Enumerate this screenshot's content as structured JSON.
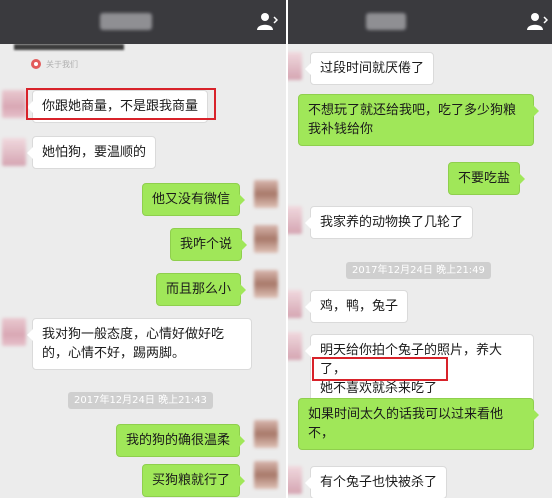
{
  "left_panel": {
    "note_text": "关于我们",
    "messages": [
      {
        "side": "in",
        "text": "你跟她商量，不是跟我商量"
      },
      {
        "side": "in",
        "text": "她怕狗，要温顺的"
      },
      {
        "side": "out",
        "text": "他又没有微信"
      },
      {
        "side": "out",
        "text": "我咋个说"
      },
      {
        "side": "out",
        "text": "而且那么小"
      },
      {
        "side": "in",
        "text": "我对狗一般态度，心情好做好吃的，心情不好，踢两脚。"
      },
      {
        "side": "out",
        "text": "我的狗的确很温柔"
      },
      {
        "side": "out",
        "text": "买狗粮就行了"
      }
    ],
    "timestamp": "2017年12月24日 晚上21:43"
  },
  "right_panel": {
    "messages": [
      {
        "side": "in",
        "text": "过段时间就厌倦了"
      },
      {
        "side": "out",
        "text": "不想玩了就还给我吧，吃了多少狗粮我补钱给你"
      },
      {
        "side": "out",
        "text": "不要吃盐"
      },
      {
        "side": "in",
        "text": "我家养的动物换了几轮了"
      },
      {
        "side": "in",
        "text": "鸡，鸭，兔子"
      },
      {
        "side": "in",
        "text_line1": "明天给你拍个兔子的照片，养大了，",
        "text_line2": "她不喜欢就杀来吃了"
      },
      {
        "side": "out",
        "text": "如果时间太久的话我可以过来看他不，"
      },
      {
        "side": "in",
        "text": "有个兔子也快被杀了"
      }
    ],
    "timestamp": "2017年12月24日 晚上21:49"
  },
  "colors": {
    "topbar": "#3a3a3e",
    "chat_background": "#ececec",
    "outgoing_bubble": "#a0e759",
    "incoming_bubble": "#ffffff",
    "highlight_box": "#d8222a"
  },
  "icons": [
    "person-icon",
    "location-icon"
  ]
}
